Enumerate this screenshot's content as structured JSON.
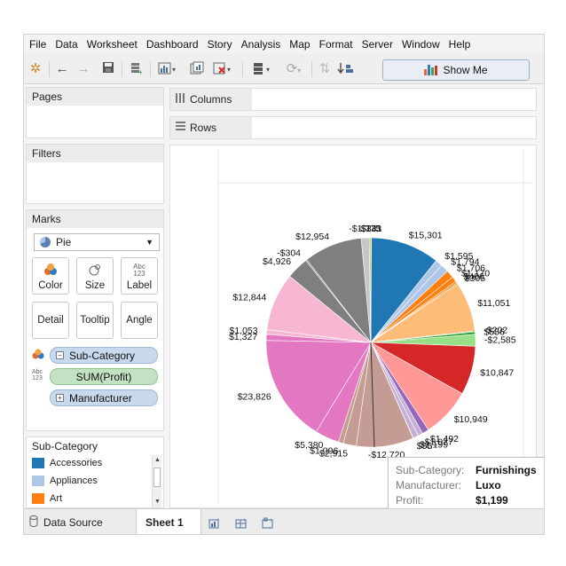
{
  "menu": [
    "File",
    "Data",
    "Worksheet",
    "Dashboard",
    "Story",
    "Analysis",
    "Map",
    "Format",
    "Server",
    "Window",
    "Help"
  ],
  "toolbar": {
    "show_me_label": "Show Me"
  },
  "panels": {
    "pages": "Pages",
    "filters": "Filters",
    "marks": "Marks",
    "legend": "Sub-Category"
  },
  "marks": {
    "mark_type": "Pie",
    "buttons": {
      "color": "Color",
      "size": "Size",
      "label": "Label",
      "detail": "Detail",
      "tooltip": "Tooltip",
      "angle": "Angle"
    },
    "label_icon_text": "Abc 123",
    "pills": {
      "color": "Sub-Category",
      "label": "SUM(Profit)",
      "detail": "Manufacturer"
    }
  },
  "legend": [
    {
      "label": "Accessories",
      "color": "#1f77b4"
    },
    {
      "label": "Appliances",
      "color": "#aec7e8"
    },
    {
      "label": "Art",
      "color": "#ff7f0e"
    }
  ],
  "shelves": {
    "columns": "Columns",
    "rows": "Rows"
  },
  "chart_data": {
    "type": "pie",
    "slices": [
      {
        "color": "#1f77b4",
        "values": [
          133,
          15301
        ]
      },
      {
        "color": "#aec7e8",
        "values": [
          1595,
          1794
        ]
      },
      {
        "color": "#ff7f0e",
        "values": [
          1706,
          1170,
          406,
          305
        ]
      },
      {
        "color": "#ffbb78",
        "values": [
          11051
        ]
      },
      {
        "color": "#2ca02c",
        "values": [
          -202,
          556
        ]
      },
      {
        "color": "#98df8a",
        "values": [
          -2585
        ]
      },
      {
        "color": "#d62728",
        "values": [
          10847
        ]
      },
      {
        "color": "#ff9896",
        "values": [
          10949
        ]
      },
      {
        "color": "#9467bd",
        "values": [
          1492
        ]
      },
      {
        "color": "#c5b0d5",
        "values": [
          1077,
          1199
        ]
      },
      {
        "color": "#8c564b",
        "values": [
          55
        ]
      },
      {
        "color": "#c49c94",
        "values": [
          -12720,
          2915,
          1096
        ]
      },
      {
        "color": "#e377c2",
        "values": [
          5380,
          23826,
          1327
        ]
      },
      {
        "color": "#f7b6d2",
        "values": [
          1053,
          12844
        ]
      },
      {
        "color": "#7f7f7f",
        "values": [
          4926,
          -304,
          12954
        ]
      },
      {
        "color": "#c7c7c7",
        "values": [
          -1775
        ]
      },
      {
        "color": "#bcbd22",
        "values": [
          -341
        ]
      }
    ],
    "labels": [
      "$133",
      "$15,301",
      "$1,595",
      "$1,794",
      "$1,706",
      "$1,170",
      "$406",
      "$305",
      "$11,051",
      "-$202",
      "$556",
      "-$2,585",
      "$10,847",
      "$10,949",
      "$1,492",
      "$1,077",
      "$1,199",
      "$55",
      "-$12,720",
      "$2,915",
      "$1,096",
      "$5,380",
      "$23,826",
      "$1,327",
      "$1,053",
      "$12,844",
      "$4,926",
      "-$304",
      "$12,954",
      "-$1,775",
      "-$341"
    ]
  },
  "tooltip": {
    "rows": [
      {
        "key": "Sub-Category:",
        "value": "Furnishings"
      },
      {
        "key": "Manufacturer:",
        "value": "Luxo"
      },
      {
        "key": "Profit:",
        "value": "$1,199"
      }
    ]
  },
  "tabs": {
    "data_source": "Data Source",
    "sheet": "Sheet 1"
  }
}
